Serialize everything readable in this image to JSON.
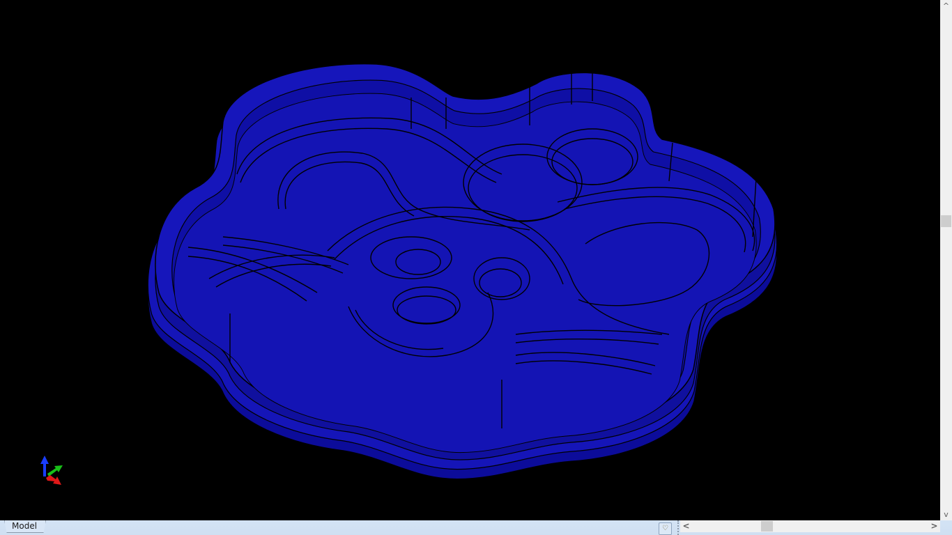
{
  "layout_tabs": [
    {
      "label": "Model",
      "active": true
    }
  ],
  "icons": {
    "favorite": "heart-icon",
    "ucs": "ucs-axis-icon",
    "scroll_left": "chevron-left-icon",
    "scroll_right": "chevron-right-icon",
    "scroll_up": "chevron-up-icon",
    "scroll_down": "chevron-down-icon"
  },
  "glyphs": {
    "heart": "♡",
    "left": "<",
    "right": ">",
    "up": "^",
    "down": "v"
  },
  "colors": {
    "viewport_bg": "#000000",
    "model": "#1414b4",
    "statusbar": "#d3e3f4"
  }
}
